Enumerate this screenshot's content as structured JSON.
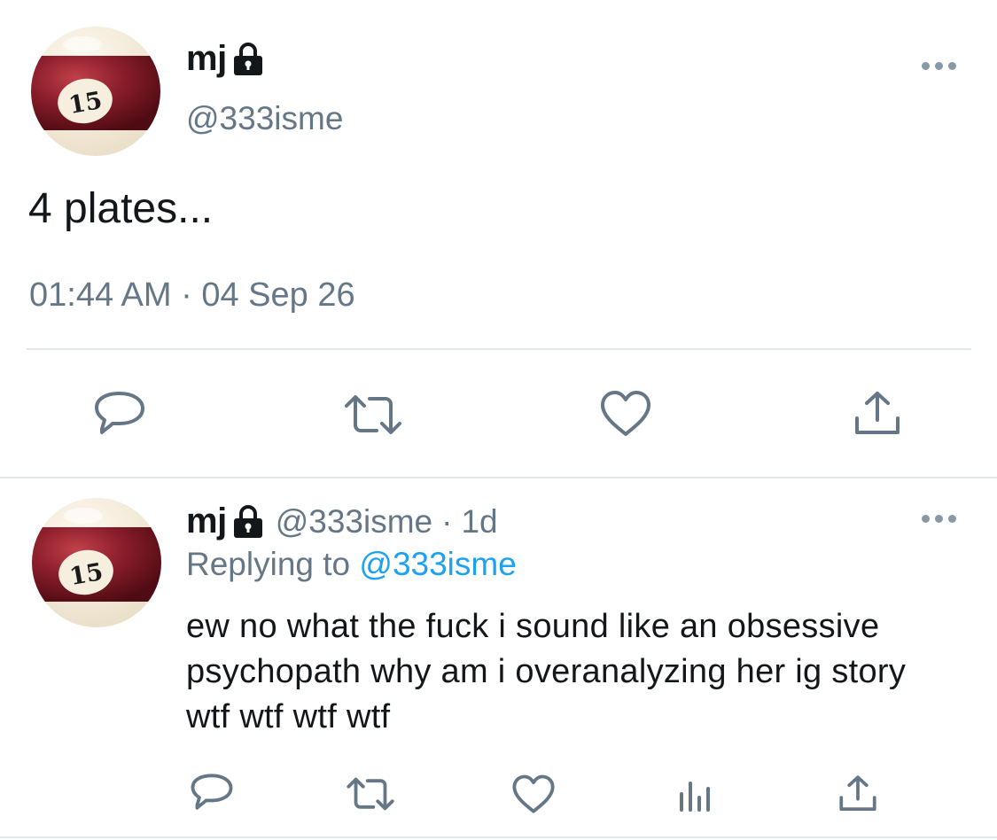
{
  "tweet": {
    "display_name": "mj",
    "handle": "@333isme",
    "text": "4 plates...",
    "timestamp": "01:44 AM · 04 Sep 26",
    "avatar_number": "15"
  },
  "reply": {
    "display_name": "mj",
    "handle": "@333isme",
    "separator": "·",
    "age": "1d",
    "replying_prefix": "Replying to ",
    "replying_handle": "@333isme",
    "text": "ew no what the fuck i sound like an obsessive psychopath why am i overanalyzing her ig story  wtf wtf wtf wtf",
    "avatar_number": "15"
  },
  "colors": {
    "text_primary": "#14171a",
    "text_secondary": "#657786",
    "link": "#1da1f2",
    "icon": "#657786",
    "divider": "#e1e8ed"
  }
}
